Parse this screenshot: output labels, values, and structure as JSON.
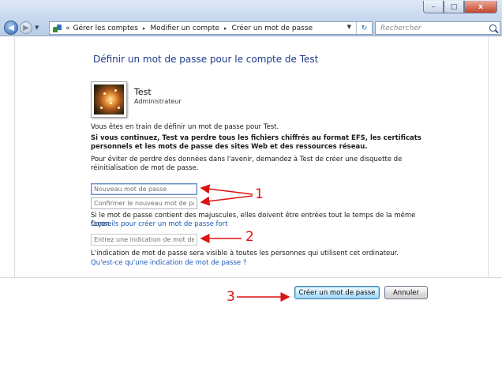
{
  "window": {
    "controls": {
      "minimize": "–",
      "maximize": "□",
      "close": "x"
    }
  },
  "nav": {
    "back_icon": "back-arrow-icon",
    "forward_icon": "forward-arrow-icon",
    "dropdown_icon": "chevron-down-icon"
  },
  "address": {
    "chevrons": "«",
    "crumbs": [
      "Gérer les comptes",
      "Modifier un compte",
      "Créer un mot de passe"
    ],
    "separator": "▸",
    "refresh": "↻"
  },
  "search": {
    "placeholder": "Rechercher"
  },
  "page": {
    "title": "Définir un mot de passe pour le compte de Test",
    "account_name": "Test",
    "account_role": "Administrateur",
    "intro": "Vous êtes en train de définir un mot de passe pour Test.",
    "warning": "Si vous continuez, Test va perdre tous les fichiers chiffrés au format EFS, les certificats personnels et les mots de passe des sites Web et des ressources réseau.",
    "advice": "Pour éviter de perdre des données dans l'avenir, demandez à Test de créer une disquette de réinitialisation de mot de passe.",
    "new_password_placeholder": "Nouveau mot de passe",
    "confirm_password_placeholder": "Confirmer le nouveau mot de pas",
    "case_note": "Si le mot de passe contient des majuscules, elles doivent être entrées tout le temps de la même façon.",
    "strong_link": "Conseils pour créer un mot de passe fort",
    "hint_placeholder": "Entrez une indication de mot de p",
    "hint_note": "L'indication de mot de passe sera visible à toutes les personnes qui utilisent cet ordinateur.",
    "hint_link": "Qu'est-ce qu'une indication de mot de passe ?",
    "create_button": "Créer un mot de passe",
    "cancel_button": "Annuler"
  },
  "annotations": [
    "1",
    "2",
    "3"
  ],
  "colors": {
    "annotation": "#dd1111",
    "link": "#1c58b8",
    "title": "#1e3a8a"
  }
}
